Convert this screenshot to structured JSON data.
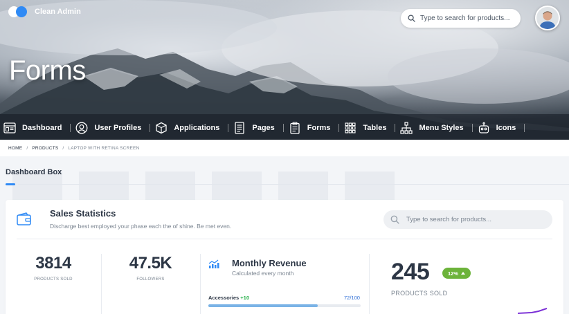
{
  "app": {
    "name": "Clean Admin"
  },
  "header": {
    "search_placeholder": "Type to search for products..."
  },
  "hero": {
    "title": "Forms"
  },
  "nav": [
    {
      "label": "Dashboard",
      "icon": "dashboard-icon"
    },
    {
      "label": "User Profiles",
      "icon": "user-circle-icon"
    },
    {
      "label": "Applications",
      "icon": "cube-icon"
    },
    {
      "label": "Pages",
      "icon": "page-icon"
    },
    {
      "label": "Forms",
      "icon": "clipboard-icon"
    },
    {
      "label": "Tables",
      "icon": "grid-icon"
    },
    {
      "label": "Menu Styles",
      "icon": "sitemap-icon"
    },
    {
      "label": "Icons",
      "icon": "robot-icon"
    }
  ],
  "breadcrumb": {
    "home": "HOME",
    "products": "PRODUCTS",
    "current": "LAPTOP WITH RETINA SCREEN",
    "separator": "/"
  },
  "section": {
    "title": "Dashboard Box"
  },
  "card": {
    "title": "Sales Statistics",
    "subtitle": "Discharge best employed your phase each the of shine. Be met even.",
    "search_placeholder": "Type to search for products...",
    "stats": [
      {
        "value": "3814",
        "label": "PRODUCTS SOLD"
      },
      {
        "value": "47.5K",
        "label": "FOLLOWERS"
      }
    ],
    "revenue": {
      "title": "Monthly Revenue",
      "subtitle": "Calculated every month",
      "progress_label": "Accessories",
      "progress_delta": "+10",
      "progress_count": "72/100",
      "progress_fraction": 0.72
    },
    "highlight": {
      "value": "245",
      "badge": "12%",
      "label": "PRODUCTS SOLD"
    }
  },
  "colors": {
    "accent": "#2f8af5",
    "success": "#6cb33a",
    "text": "#2c3645",
    "muted": "#7b8591"
  }
}
